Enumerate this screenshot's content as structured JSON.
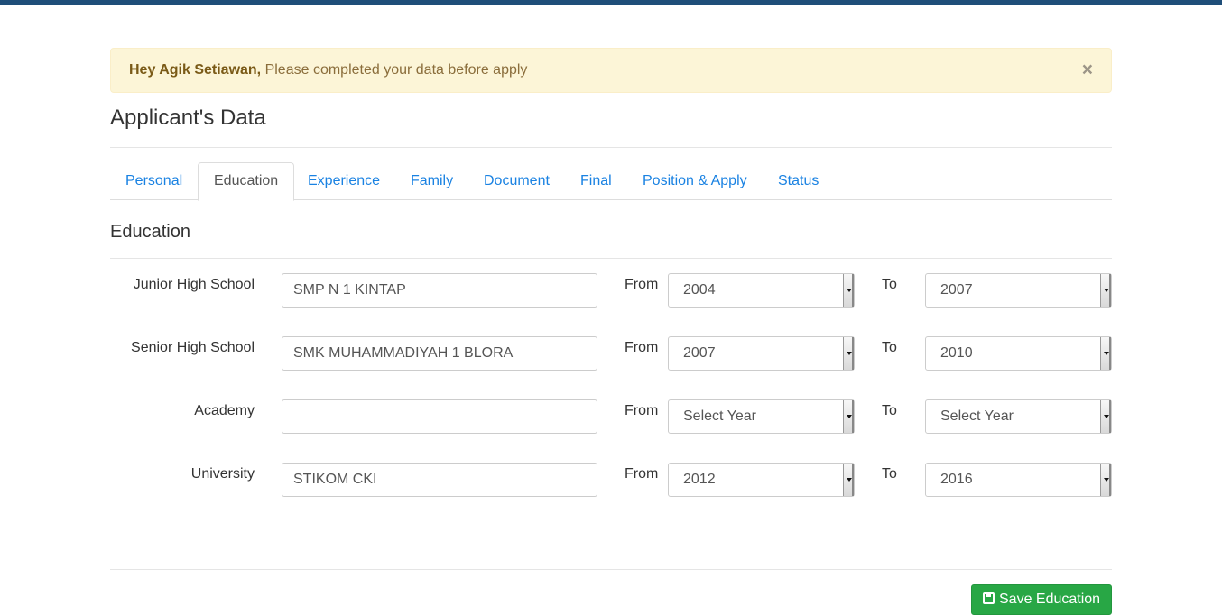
{
  "alert": {
    "name": "Hey Agik Setiawan,",
    "message": " Please completed your data before apply",
    "close": "×"
  },
  "page_title": "Applicant's Data",
  "tabs": [
    {
      "label": "Personal"
    },
    {
      "label": "Education"
    },
    {
      "label": "Experience"
    },
    {
      "label": "Family"
    },
    {
      "label": "Document"
    },
    {
      "label": "Final"
    },
    {
      "label": "Position & Apply"
    },
    {
      "label": "Status"
    }
  ],
  "active_tab": "Education",
  "section_title": "Education",
  "from_label": "From",
  "to_label": "To",
  "rows": [
    {
      "label": "Junior High School",
      "school": "SMP N 1 KINTAP",
      "from": "2004",
      "to": "2007"
    },
    {
      "label": "Senior High School",
      "school": "SMK MUHAMMADIYAH 1 BLORA",
      "from": "2007",
      "to": "2010"
    },
    {
      "label": "Academy",
      "school": "",
      "from": "Select Year",
      "to": "Select Year"
    },
    {
      "label": "University",
      "school": "STIKOM CKI",
      "from": "2012",
      "to": "2016"
    }
  ],
  "save_button": "Save Education",
  "colors": {
    "topbar": "#1f4e79",
    "alert_bg": "#fcf5d7",
    "link": "#1a82e2",
    "save": "#28a745"
  }
}
